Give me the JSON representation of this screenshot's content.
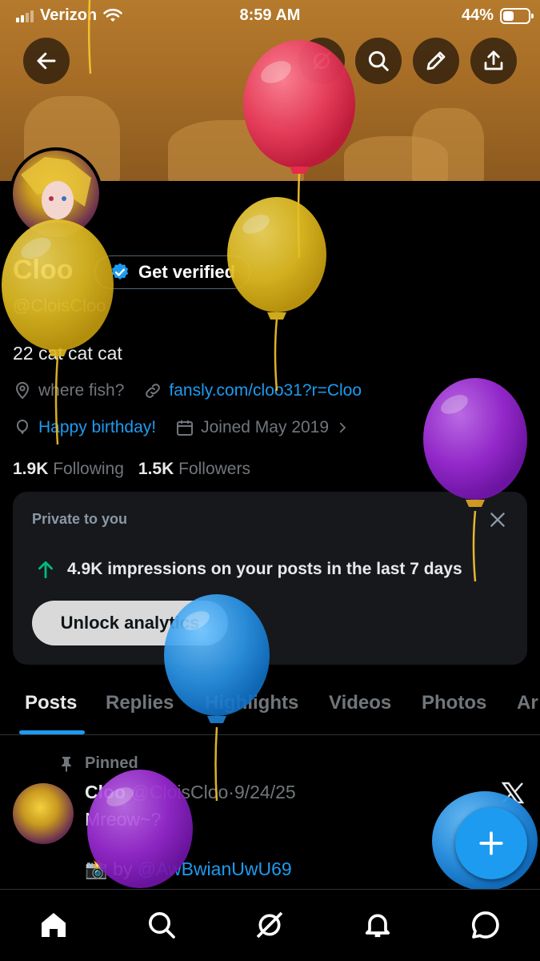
{
  "status_bar": {
    "carrier": "Verizon",
    "time": "8:59 AM",
    "battery": "44%"
  },
  "header": {
    "back_icon": "arrow-left-icon",
    "grok_icon": "grok-icon",
    "search_icon": "search-icon",
    "edit_icon": "pencil-icon",
    "share_icon": "share-icon"
  },
  "profile": {
    "name": "Cloo",
    "get_verified_label": "Get verified",
    "handle": "@CloisCloo",
    "bio": "22 cat cat cat",
    "location": "where fish?",
    "link": "fansly.com/cloo31?r=Cloo",
    "birthday": "Happy birthday!",
    "joined": "Joined May 2019",
    "following_count": "1.9K",
    "following_label": "Following",
    "followers_count": "1.5K",
    "followers_label": "Followers"
  },
  "private_card": {
    "title": "Private to you",
    "impressions": "4.9K impressions on your posts in the last 7 days",
    "unlock_label": "Unlock analytics"
  },
  "tabs": [
    "Posts",
    "Replies",
    "Highlights",
    "Videos",
    "Photos",
    "Ar"
  ],
  "pinned_post": {
    "pinned_label": "Pinned",
    "author": "Cloo",
    "handle": "@CloisCloo",
    "separator": "·",
    "date": "9/24/25",
    "text": "Mreow~?",
    "credit_prefix": "📸 by ",
    "credit_handle": "@AwBwianUwU69"
  },
  "bottom_nav": [
    "home-icon",
    "search-icon",
    "grok-icon",
    "bell-icon",
    "messages-icon"
  ],
  "colors": {
    "accent": "#1d9bf0",
    "background": "#000000",
    "muted": "#71767b"
  }
}
